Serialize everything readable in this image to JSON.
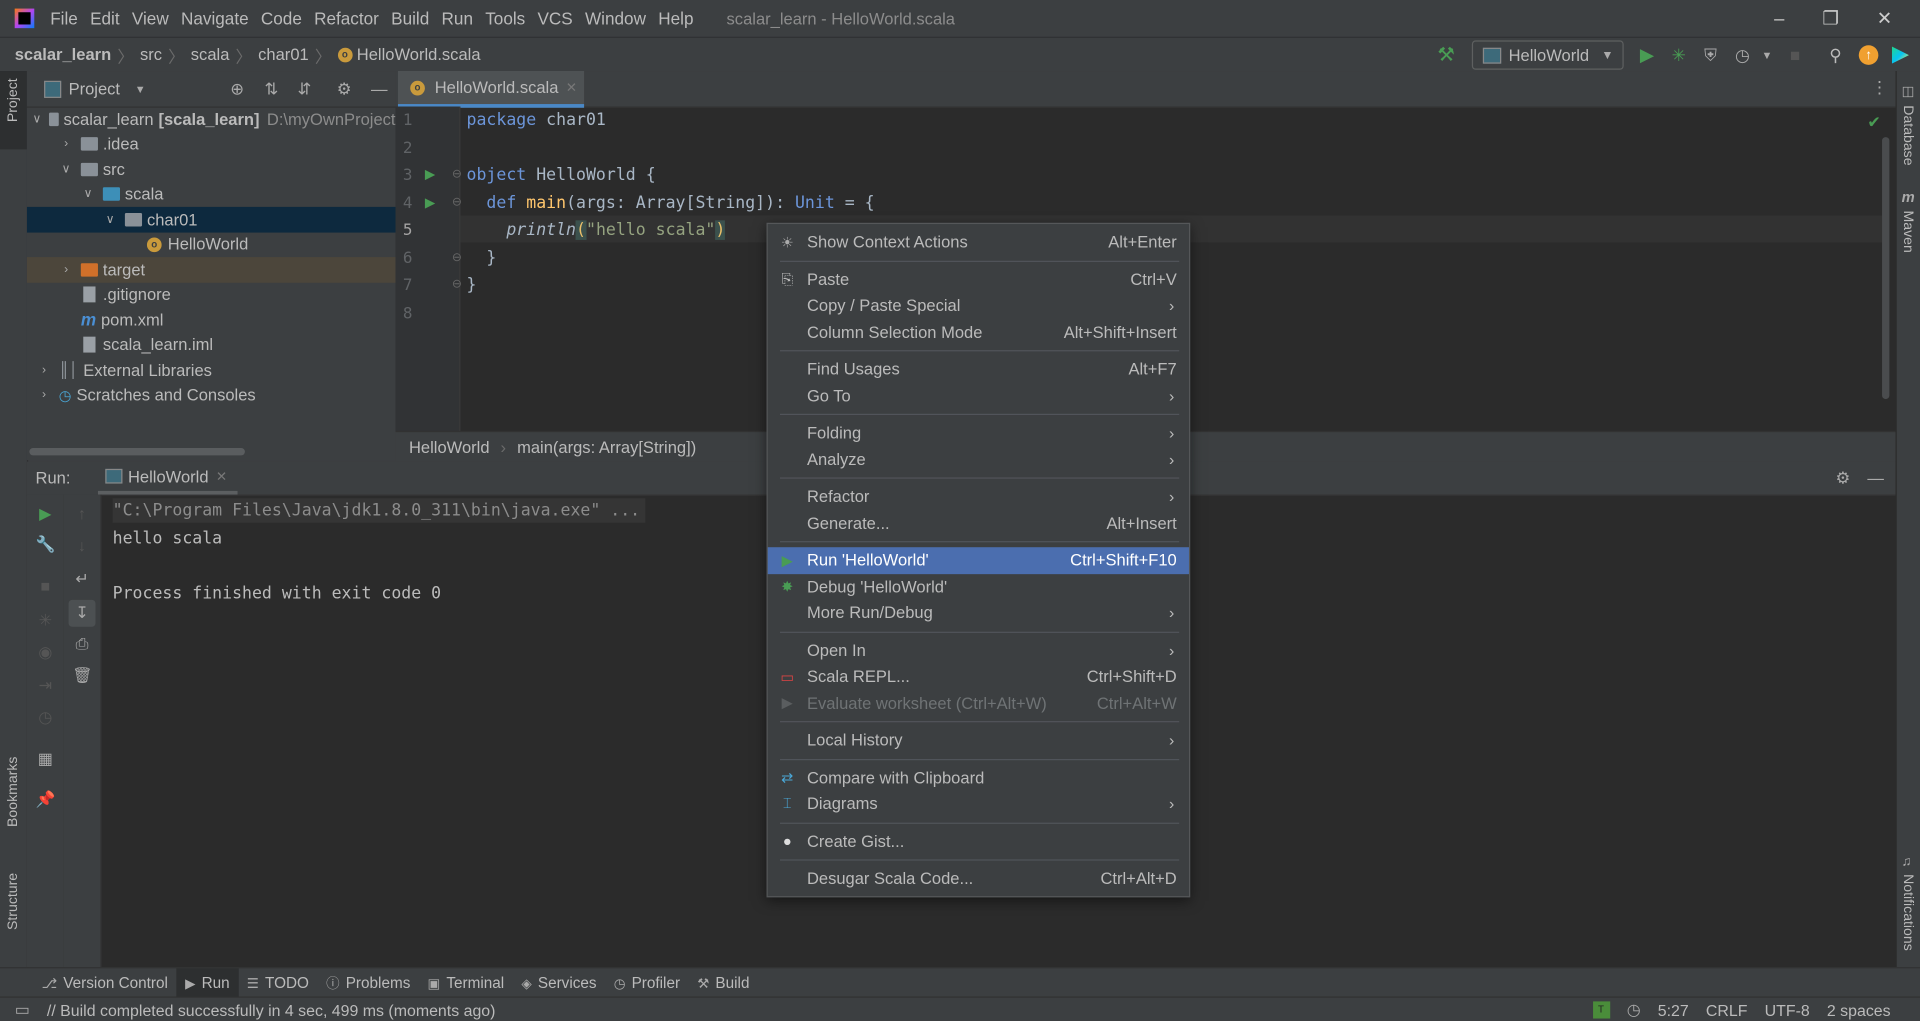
{
  "menubar": {
    "items": [
      "File",
      "Edit",
      "View",
      "Navigate",
      "Code",
      "Refactor",
      "Build",
      "Run",
      "Tools",
      "VCS",
      "Window",
      "Help"
    ],
    "window_title": "scalar_learn - HelloWorld.scala"
  },
  "navbar": {
    "breadcrumbs": [
      "scalar_learn",
      "src",
      "scala",
      "char01",
      "HelloWorld.scala"
    ],
    "run_config": "HelloWorld"
  },
  "left_stripe": {
    "project": "Project",
    "bookmarks": "Bookmarks",
    "structure": "Structure"
  },
  "right_stripe": {
    "database": "Database",
    "maven": "Maven",
    "notifications": "Notifications"
  },
  "project_panel": {
    "title": "Project",
    "tree": [
      {
        "label": "scalar_learn",
        "bold": "[scala_learn]",
        "path": "D:\\myOwnProject",
        "depth": 0,
        "arrow": "v",
        "icon": "module"
      },
      {
        "label": ".idea",
        "depth": 1,
        "arrow": ">",
        "icon": "folder"
      },
      {
        "label": "src",
        "depth": 1,
        "arrow": "v",
        "icon": "folder"
      },
      {
        "label": "scala",
        "depth": 2,
        "arrow": "v",
        "icon": "source-folder"
      },
      {
        "label": "char01",
        "depth": 3,
        "arrow": "v",
        "icon": "package",
        "selected": true
      },
      {
        "label": "HelloWorld",
        "depth": 4,
        "arrow": "",
        "icon": "scala-object"
      },
      {
        "label": "target",
        "depth": 1,
        "arrow": ">",
        "icon": "excluded-folder",
        "excluded": true
      },
      {
        "label": ".gitignore",
        "depth": 1,
        "arrow": "",
        "icon": "file"
      },
      {
        "label": "pom.xml",
        "depth": 1,
        "arrow": "",
        "icon": "maven"
      },
      {
        "label": "scala_learn.iml",
        "depth": 1,
        "arrow": "",
        "icon": "file"
      },
      {
        "label": "External Libraries",
        "depth": 0,
        "arrow": ">",
        "icon": "libraries"
      },
      {
        "label": "Scratches and Consoles",
        "depth": 0,
        "arrow": ">",
        "icon": "scratches"
      }
    ]
  },
  "editor": {
    "tab": "HelloWorld.scala",
    "line_numbers": [
      "1",
      "2",
      "3",
      "4",
      "5",
      "6",
      "7",
      "8"
    ],
    "lines": [
      [
        {
          "t": "package",
          "c": "kw"
        },
        {
          "t": " char01",
          "c": "id"
        }
      ],
      [],
      [
        {
          "t": "object",
          "c": "kw"
        },
        {
          "t": " HelloWorld {",
          "c": "id"
        }
      ],
      [
        {
          "t": "  def",
          "c": "kw"
        },
        {
          "t": " ",
          "c": "id"
        },
        {
          "t": "main",
          "c": "fn"
        },
        {
          "t": "(args: Array[String]): ",
          "c": "id"
        },
        {
          "t": "Unit",
          "c": "kw"
        },
        {
          "t": " = {",
          "c": "id"
        }
      ],
      [
        {
          "t": "    ",
          "c": "id"
        },
        {
          "t": "println",
          "c": "it"
        },
        {
          "t": "(",
          "c": "br"
        },
        {
          "t": "\"hello scala\"",
          "c": "str"
        },
        {
          "t": ")",
          "c": "br"
        }
      ],
      [
        {
          "t": "  }",
          "c": "id"
        }
      ],
      [
        {
          "t": "}",
          "c": "id"
        }
      ],
      []
    ],
    "breadcrumb": [
      "HelloWorld",
      "main(args: Array[String])"
    ]
  },
  "run_panel": {
    "label": "Run:",
    "tab": "HelloWorld",
    "console": [
      "\"C:\\Program Files\\Java\\jdk1.8.0_311\\bin\\java.exe\" ...",
      "hello scala",
      "",
      "Process finished with exit code 0"
    ]
  },
  "context_menu": {
    "groups": [
      [
        {
          "label": "Show Context Actions",
          "shortcut": "Alt+Enter",
          "icon": "bulb"
        }
      ],
      [
        {
          "label": "Paste",
          "shortcut": "Ctrl+V",
          "icon": "clipboard"
        },
        {
          "label": "Copy / Paste Special",
          "submenu": true
        },
        {
          "label": "Column Selection Mode",
          "shortcut": "Alt+Shift+Insert"
        }
      ],
      [
        {
          "label": "Find Usages",
          "shortcut": "Alt+F7"
        },
        {
          "label": "Go To",
          "submenu": true
        }
      ],
      [
        {
          "label": "Folding",
          "submenu": true
        },
        {
          "label": "Analyze",
          "submenu": true
        }
      ],
      [
        {
          "label": "Refactor",
          "submenu": true
        },
        {
          "label": "Generate...",
          "shortcut": "Alt+Insert"
        }
      ],
      [
        {
          "label": "Run 'HelloWorld'",
          "shortcut": "Ctrl+Shift+F10",
          "icon": "run",
          "highlighted": true
        },
        {
          "label": "Debug 'HelloWorld'",
          "icon": "debug"
        },
        {
          "label": "More Run/Debug",
          "submenu": true
        }
      ],
      [
        {
          "label": "Open In",
          "submenu": true
        },
        {
          "label": "Scala REPL...",
          "shortcut": "Ctrl+Shift+D",
          "icon": "repl"
        },
        {
          "label": "Evaluate worksheet (Ctrl+Alt+W)",
          "shortcut": "Ctrl+Alt+W",
          "icon": "run",
          "disabled": true
        }
      ],
      [
        {
          "label": "Local History",
          "submenu": true
        }
      ],
      [
        {
          "label": "Compare with Clipboard",
          "icon": "compare"
        },
        {
          "label": "Diagrams",
          "submenu": true,
          "icon": "diagram"
        }
      ],
      [
        {
          "label": "Create Gist...",
          "icon": "github"
        }
      ],
      [
        {
          "label": "Desugar Scala Code...",
          "shortcut": "Ctrl+Alt+D"
        }
      ]
    ]
  },
  "tool_windows": [
    {
      "label": "Version Control",
      "icon": "vcs"
    },
    {
      "label": "Run",
      "icon": "run",
      "active": true
    },
    {
      "label": "TODO",
      "icon": "list"
    },
    {
      "label": "Problems",
      "icon": "problems"
    },
    {
      "label": "Terminal",
      "icon": "terminal"
    },
    {
      "label": "Services",
      "icon": "services"
    },
    {
      "label": "Profiler",
      "icon": "profiler"
    },
    {
      "label": "Build",
      "icon": "hammer"
    }
  ],
  "status_bar": {
    "message": "// Build completed successfully in 4 sec, 499 ms (moments ago)",
    "position": "5:27",
    "line_separator": "CRLF",
    "encoding": "UTF-8",
    "indent": "2 spaces"
  },
  "colors": {
    "accent": "#4b6eaf",
    "run_green": "#499c54",
    "selection": "#0d293e",
    "update_badge": "#f0a030"
  }
}
